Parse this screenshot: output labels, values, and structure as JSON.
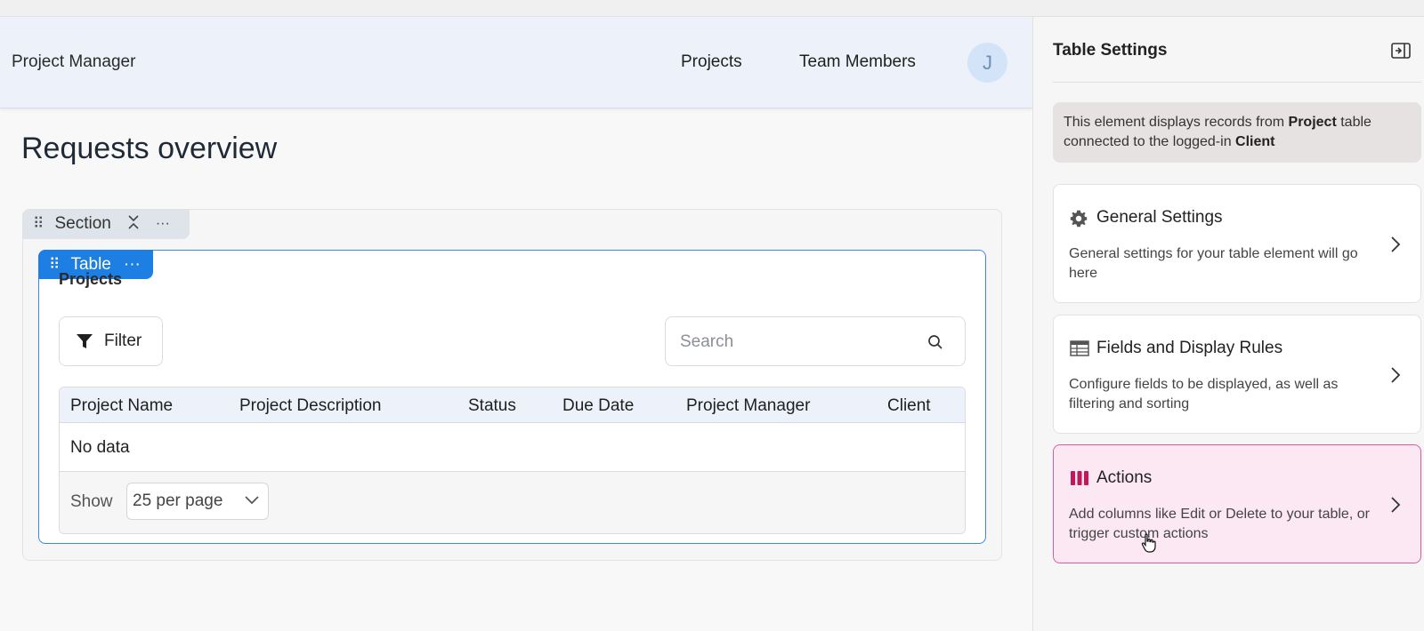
{
  "app": {
    "brand": "Project Manager",
    "nav": {
      "projects": "Projects",
      "team_members": "Team Members"
    },
    "avatar_initial": "J"
  },
  "page": {
    "title": "Requests overview",
    "section_label": "Section",
    "table_label": "Table",
    "table_title": "Projects",
    "filter_label": "Filter",
    "search_placeholder": "Search",
    "columns": [
      "Project Name",
      "Project Description",
      "Status",
      "Due Date",
      "Project Manager",
      "Client"
    ],
    "empty_text": "No data",
    "show_label": "Show",
    "per_page": "25 per page"
  },
  "panel": {
    "title": "Table Settings",
    "info": {
      "pre": "This element displays records from ",
      "table_name": "Project",
      "mid": " table connected to the logged-in ",
      "user_type": "Client"
    },
    "cards": [
      {
        "title": "General Settings",
        "description": "General settings for your table element will go here",
        "icon": "gear-icon"
      },
      {
        "title": "Fields and Display Rules",
        "description": "Configure fields to be displayed, as well as filtering and sorting",
        "icon": "table-icon"
      },
      {
        "title": "Actions",
        "description": "Add columns like Edit or Delete to your table, or trigger custom actions",
        "icon": "columns-icon"
      }
    ]
  },
  "colors": {
    "accent_blue": "#1d7fe4",
    "actions_pink": "#c2185b",
    "actions_bg": "#fce8f2"
  }
}
